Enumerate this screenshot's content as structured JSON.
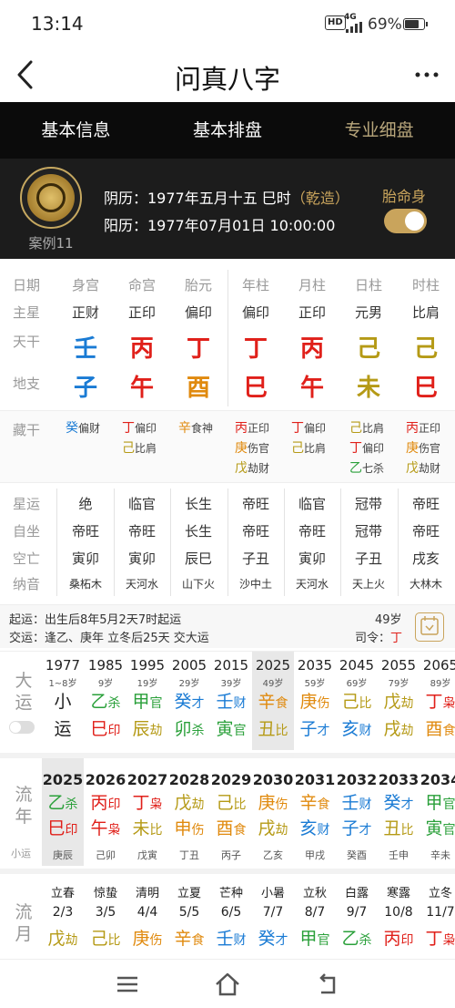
{
  "status": {
    "time": "13:14",
    "hd": "HD",
    "net": "4G",
    "battery": "69%"
  },
  "header": {
    "title": "问真八字"
  },
  "tabs": [
    "基本信息",
    "基本排盘",
    "专业细盘"
  ],
  "profile": {
    "case": "案例11",
    "lunar_label": "阴历：1977年五月十五 巳时",
    "lunar_tag": "（乾造）",
    "solar": "阳历：1977年07月01日 10:00:00",
    "taimingshen": "胎命身",
    "toggle_on": true
  },
  "pillars": {
    "labels": {
      "riqi": "日期",
      "zhuxing": "主星",
      "tiangan": "天干",
      "dizhi": "地支"
    },
    "columns": [
      {
        "name": "身宫",
        "star": "正财",
        "gan": "壬",
        "gan_color": "#1a7bd4",
        "zhi": "子",
        "zhi_color": "#1a7bd4"
      },
      {
        "name": "命宫",
        "star": "正印",
        "gan": "丙",
        "gan_color": "#e0201a",
        "zhi": "午",
        "zhi_color": "#e0201a"
      },
      {
        "name": "胎元",
        "star": "偏印",
        "gan": "丁",
        "gan_color": "#e0201a",
        "zhi": "酉",
        "zhi_color": "#e08a0e"
      },
      {
        "name": "年柱",
        "star": "偏印",
        "gan": "丁",
        "gan_color": "#e0201a",
        "zhi": "巳",
        "zhi_color": "#e0201a"
      },
      {
        "name": "月柱",
        "star": "正印",
        "gan": "丙",
        "gan_color": "#e0201a",
        "zhi": "午",
        "zhi_color": "#e0201a"
      },
      {
        "name": "日柱",
        "star": "元男",
        "gan": "己",
        "gan_color": "#b59a16",
        "zhi": "未",
        "zhi_color": "#b59a16"
      },
      {
        "name": "时柱",
        "star": "比肩",
        "gan": "己",
        "gan_color": "#b59a16",
        "zhi": "巳",
        "zhi_color": "#e0201a"
      }
    ]
  },
  "canggan": {
    "label": "藏干",
    "columns": [
      [
        {
          "g": "癸",
          "c": "#1a7bd4",
          "s": "偏财"
        }
      ],
      [
        {
          "g": "丁",
          "c": "#e0201a",
          "s": "偏印"
        },
        {
          "g": "己",
          "c": "#b59a16",
          "s": "比肩"
        }
      ],
      [
        {
          "g": "辛",
          "c": "#e08a0e",
          "s": "食神"
        }
      ],
      [
        {
          "g": "丙",
          "c": "#e0201a",
          "s": "正印"
        },
        {
          "g": "庚",
          "c": "#e08a0e",
          "s": "伤官"
        },
        {
          "g": "戊",
          "c": "#b59a16",
          "s": "劫财"
        }
      ],
      [
        {
          "g": "丁",
          "c": "#e0201a",
          "s": "偏印"
        },
        {
          "g": "己",
          "c": "#b59a16",
          "s": "比肩"
        }
      ],
      [
        {
          "g": "己",
          "c": "#b59a16",
          "s": "比肩"
        },
        {
          "g": "丁",
          "c": "#e0201a",
          "s": "偏印"
        },
        {
          "g": "乙",
          "c": "#2aa03a",
          "s": "七杀"
        }
      ],
      [
        {
          "g": "丙",
          "c": "#e0201a",
          "s": "正印"
        },
        {
          "g": "庚",
          "c": "#e08a0e",
          "s": "伤官"
        },
        {
          "g": "戊",
          "c": "#b59a16",
          "s": "劫财"
        }
      ]
    ]
  },
  "xingyun": {
    "labels": [
      "星运",
      "自坐",
      "空亡",
      "纳音"
    ],
    "rows": [
      [
        "绝",
        "临官",
        "长生",
        "帝旺",
        "临官",
        "冠带",
        "帝旺"
      ],
      [
        "帝旺",
        "帝旺",
        "长生",
        "帝旺",
        "帝旺",
        "冠带",
        "帝旺"
      ],
      [
        "寅卯",
        "寅卯",
        "辰巳",
        "子丑",
        "寅卯",
        "子丑",
        "戌亥"
      ],
      [
        "桑柘木",
        "天河水",
        "山下火",
        "沙中土",
        "天河水",
        "天上火",
        "大林木"
      ]
    ]
  },
  "qiyun": {
    "line1": "起运：出生后8年5月2天7时起运",
    "line2": "交运：逢乙、庚年 立冬后25天 交大运",
    "age": "49岁",
    "siling_label": "司令：",
    "siling": "丁"
  },
  "dayun": {
    "head": [
      "大",
      "运"
    ],
    "cols": [
      {
        "year": "1977",
        "age": "1~8岁",
        "g1": "小",
        "g2": "运"
      },
      {
        "year": "1985",
        "age": "9岁",
        "g1": "乙",
        "s1": "杀",
        "g2": "巳",
        "s2": "印",
        "c1": "#2aa03a",
        "c2": "#e0201a"
      },
      {
        "year": "1995",
        "age": "19岁",
        "g1": "甲",
        "s1": "官",
        "g2": "辰",
        "s2": "劫",
        "c1": "#2aa03a",
        "c2": "#b59a16"
      },
      {
        "year": "2005",
        "age": "29岁",
        "g1": "癸",
        "s1": "才",
        "g2": "卯",
        "s2": "杀",
        "c1": "#1a7bd4",
        "c2": "#2aa03a"
      },
      {
        "year": "2015",
        "age": "39岁",
        "g1": "壬",
        "s1": "财",
        "g2": "寅",
        "s2": "官",
        "c1": "#1a7bd4",
        "c2": "#2aa03a"
      },
      {
        "year": "2025",
        "age": "49岁",
        "g1": "辛",
        "s1": "食",
        "g2": "丑",
        "s2": "比",
        "c1": "#e08a0e",
        "c2": "#b59a16",
        "hl": true
      },
      {
        "year": "2035",
        "age": "59岁",
        "g1": "庚",
        "s1": "伤",
        "g2": "子",
        "s2": "才",
        "c1": "#e08a0e",
        "c2": "#1a7bd4"
      },
      {
        "year": "2045",
        "age": "69岁",
        "g1": "己",
        "s1": "比",
        "g2": "亥",
        "s2": "财",
        "c1": "#b59a16",
        "c2": "#1a7bd4"
      },
      {
        "year": "2055",
        "age": "79岁",
        "g1": "戊",
        "s1": "劫",
        "g2": "戌",
        "s2": "劫",
        "c1": "#b59a16",
        "c2": "#b59a16"
      },
      {
        "year": "2065",
        "age": "89岁",
        "g1": "丁",
        "s1": "枭",
        "g2": "酉",
        "s2": "食",
        "c1": "#e0201a",
        "c2": "#e08a0e"
      }
    ]
  },
  "liunian": {
    "head": [
      "流",
      "年"
    ],
    "sub": "小运",
    "cols": [
      {
        "year": "2025",
        "g1": "乙",
        "s1": "杀",
        "g2": "巳",
        "s2": "印",
        "c1": "#2aa03a",
        "c2": "#e0201a",
        "xy": "庚辰",
        "hl": true
      },
      {
        "year": "2026",
        "g1": "丙",
        "s1": "印",
        "g2": "午",
        "s2": "枭",
        "c1": "#e0201a",
        "c2": "#e0201a",
        "xy": "己卯"
      },
      {
        "year": "2027",
        "g1": "丁",
        "s1": "枭",
        "g2": "未",
        "s2": "比",
        "c1": "#e0201a",
        "c2": "#b59a16",
        "xy": "戊寅"
      },
      {
        "year": "2028",
        "g1": "戊",
        "s1": "劫",
        "g2": "申",
        "s2": "伤",
        "c1": "#b59a16",
        "c2": "#e08a0e",
        "xy": "丁丑"
      },
      {
        "year": "2029",
        "g1": "己",
        "s1": "比",
        "g2": "酉",
        "s2": "食",
        "c1": "#b59a16",
        "c2": "#e08a0e",
        "xy": "丙子"
      },
      {
        "year": "2030",
        "g1": "庚",
        "s1": "伤",
        "g2": "戌",
        "s2": "劫",
        "c1": "#e08a0e",
        "c2": "#b59a16",
        "xy": "乙亥"
      },
      {
        "year": "2031",
        "g1": "辛",
        "s1": "食",
        "g2": "亥",
        "s2": "财",
        "c1": "#e08a0e",
        "c2": "#1a7bd4",
        "xy": "甲戌"
      },
      {
        "year": "2032",
        "g1": "壬",
        "s1": "财",
        "g2": "子",
        "s2": "才",
        "c1": "#1a7bd4",
        "c2": "#1a7bd4",
        "xy": "癸酉"
      },
      {
        "year": "2033",
        "g1": "癸",
        "s1": "才",
        "g2": "丑",
        "s2": "比",
        "c1": "#1a7bd4",
        "c2": "#b59a16",
        "xy": "壬申"
      },
      {
        "year": "2034",
        "g1": "甲",
        "s1": "官",
        "g2": "寅",
        "s2": "官",
        "c1": "#2aa03a",
        "c2": "#2aa03a",
        "xy": "辛未"
      }
    ]
  },
  "liuyue": {
    "head": [
      "流",
      "月"
    ],
    "cols": [
      {
        "term": "立春",
        "date": "2/3",
        "g1": "戊",
        "s1": "劫",
        "c1": "#b59a16"
      },
      {
        "term": "惊蛰",
        "date": "3/5",
        "g1": "己",
        "s1": "比",
        "c1": "#b59a16"
      },
      {
        "term": "清明",
        "date": "4/4",
        "g1": "庚",
        "s1": "伤",
        "c1": "#e08a0e"
      },
      {
        "term": "立夏",
        "date": "5/5",
        "g1": "辛",
        "s1": "食",
        "c1": "#e08a0e"
      },
      {
        "term": "芒种",
        "date": "6/5",
        "g1": "壬",
        "s1": "财",
        "c1": "#1a7bd4"
      },
      {
        "term": "小暑",
        "date": "7/7",
        "g1": "癸",
        "s1": "才",
        "c1": "#1a7bd4"
      },
      {
        "term": "立秋",
        "date": "8/7",
        "g1": "甲",
        "s1": "官",
        "c1": "#2aa03a"
      },
      {
        "term": "白露",
        "date": "9/7",
        "g1": "乙",
        "s1": "杀",
        "c1": "#2aa03a"
      },
      {
        "term": "寒露",
        "date": "10/8",
        "g1": "丙",
        "s1": "印",
        "c1": "#e0201a"
      },
      {
        "term": "立冬",
        "date": "11/7",
        "g1": "丁",
        "s1": "枭",
        "c1": "#e0201a"
      }
    ]
  },
  "nav": [
    "menu-icon",
    "home-icon",
    "back-icon"
  ]
}
